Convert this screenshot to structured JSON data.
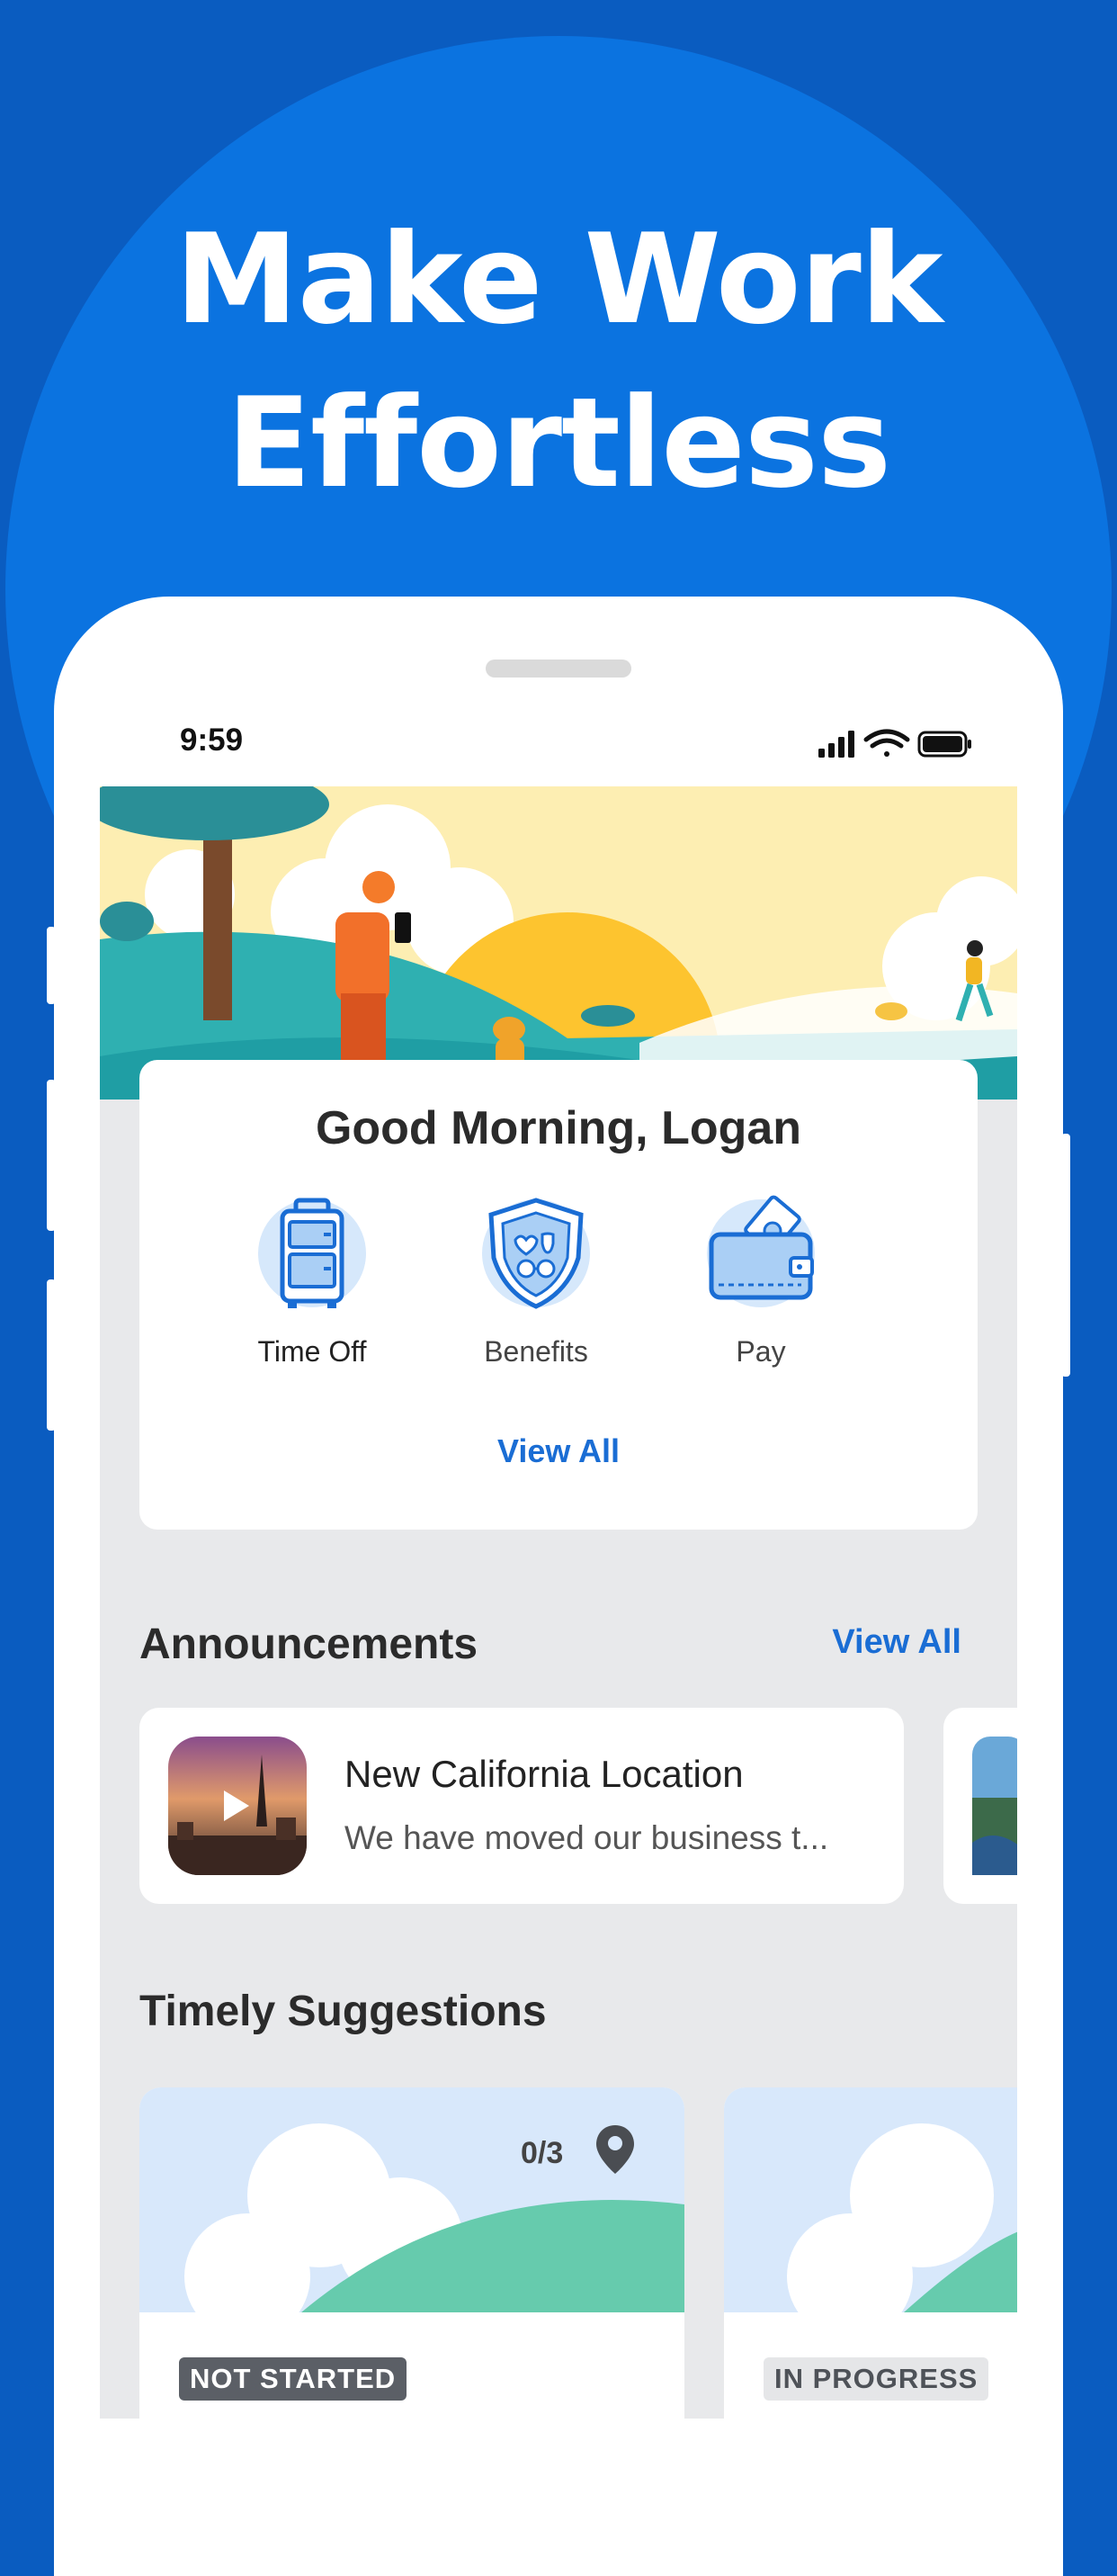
{
  "promo": {
    "headline_line1": "Make Work",
    "headline_line2": "Effortless",
    "bg_color": "#0a5cc0",
    "circle_color": "#0b73e0"
  },
  "status_bar": {
    "time": "9:59",
    "icons": [
      "cellular-signal-icon",
      "wifi-icon",
      "battery-icon"
    ]
  },
  "home": {
    "greeting": "Good Morning, Logan",
    "quick_actions": [
      {
        "label": "Time Off",
        "icon": "suitcase-icon"
      },
      {
        "label": "Benefits",
        "icon": "shield-icon"
      },
      {
        "label": "Pay",
        "icon": "wallet-icon"
      }
    ],
    "view_all": "View All"
  },
  "announcements": {
    "title": "Announcements",
    "view_all": "View All",
    "items": [
      {
        "title": "New California Location",
        "description": "We have moved our business t...",
        "thumb_icon": "play-icon"
      }
    ]
  },
  "suggestions": {
    "title": "Timely Suggestions",
    "items": [
      {
        "status": "NOT STARTED",
        "progress": "0/3",
        "icon": "location-pin-icon"
      },
      {
        "status": "IN PROGRESS"
      }
    ]
  },
  "colors": {
    "accent": "#1a6dd4",
    "screen_bg": "#e8e9eb"
  }
}
